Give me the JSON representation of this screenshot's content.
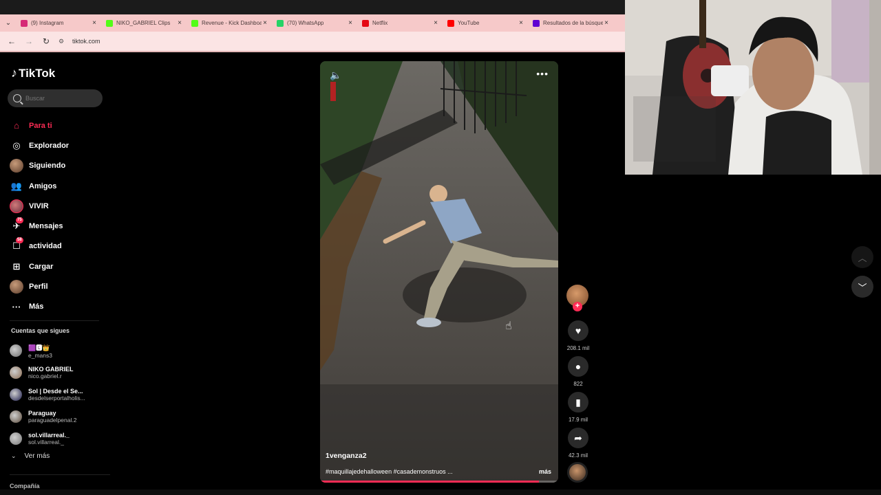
{
  "browser": {
    "tabs": [
      {
        "title": "(9) Instagram",
        "icon": "instagram-icon",
        "color": "#d62976"
      },
      {
        "title": "NIKO_GABRIEL Clips",
        "icon": "kick-icon",
        "color": "#53fc18"
      },
      {
        "title": "Revenue - Kick Dashboard",
        "icon": "kick-icon",
        "color": "#53fc18"
      },
      {
        "title": "(70) WhatsApp",
        "icon": "whatsapp-icon",
        "color": "#25d366"
      },
      {
        "title": "Netflix",
        "icon": "netflix-icon",
        "color": "#e50914"
      },
      {
        "title": "YouTube",
        "icon": "youtube-icon",
        "color": "#ff0000"
      },
      {
        "title": "Resultados de la búsqueda",
        "icon": "yahoo-icon",
        "color": "#6001d2"
      }
    ],
    "url": "tiktok.com"
  },
  "sidebar": {
    "brand": "TikTok",
    "search_placeholder": "Buscar",
    "menu": [
      {
        "label": "Para ti",
        "icon": "home-icon",
        "active": true
      },
      {
        "label": "Explorador",
        "icon": "compass-icon"
      },
      {
        "label": "Siguiendo",
        "icon": "following-avatar-icon"
      },
      {
        "label": "Amigos",
        "icon": "friends-icon"
      },
      {
        "label": "VIVIR",
        "icon": "live-avatar-icon"
      },
      {
        "label": "Mensajes",
        "icon": "messages-icon",
        "badge": "75"
      },
      {
        "label": "actividad",
        "icon": "activity-icon",
        "badge": "58"
      },
      {
        "label": "Cargar",
        "icon": "upload-icon"
      },
      {
        "label": "Perfil",
        "icon": "profile-avatar-icon"
      },
      {
        "label": "Más",
        "icon": "more-icon"
      }
    ],
    "following_header": "Cuentas que sigues",
    "following": [
      {
        "name": "🟪🅴👑",
        "user": "e_mans3"
      },
      {
        "name": "NIKO GABRIEL",
        "user": "nico.gabriel.r"
      },
      {
        "name": "Sol | Desde el Se...",
        "user": "desdelserportalholis..."
      },
      {
        "name": "Paraguay",
        "user": "paraguadelpenal.2"
      },
      {
        "name": "sol.villarreal._",
        "user": "sol.villarreal._"
      }
    ],
    "see_more": "Ver más",
    "company": "Compañía"
  },
  "video": {
    "author": "1venganza2",
    "caption": "#maquillajedehalloween #casademonstruos ...",
    "more": "más",
    "progress": 0.92
  },
  "actions": {
    "likes": "208.1 mil",
    "comments": "822",
    "saves": "17.9 mil",
    "shares": "42.3 mil"
  },
  "colors": {
    "accent": "#fe2c55",
    "tabstrip": "#f6c9c9"
  }
}
